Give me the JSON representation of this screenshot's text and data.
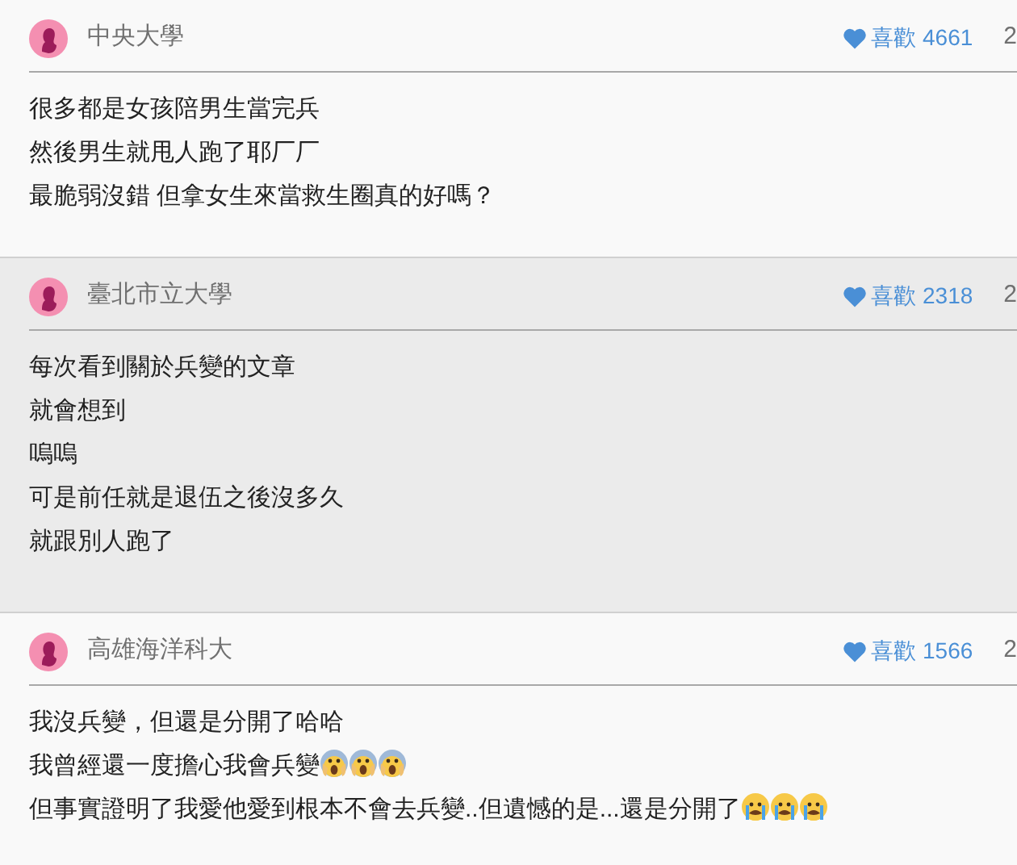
{
  "posts": [
    {
      "school": "中央大學",
      "likes": "喜歡 4661",
      "edge_text": "2",
      "highlighted": false,
      "lines": [
        {
          "text": "很多都是女孩陪男生當完兵"
        },
        {
          "text": "然後男生就甩人跑了耶厂厂"
        },
        {
          "text": "最脆弱沒錯 但拿女生來當救生圈真的好嗎？"
        }
      ]
    },
    {
      "school": "臺北市立大學",
      "likes": "喜歡 2318",
      "edge_text": "2",
      "highlighted": true,
      "lines": [
        {
          "text": "每次看到關於兵變的文章"
        },
        {
          "text": "就會想到"
        },
        {
          "text": "嗚嗚"
        },
        {
          "text": "可是前任就是退伍之後沒多久"
        },
        {
          "text": "就跟別人跑了"
        }
      ]
    },
    {
      "school": "高雄海洋科大",
      "likes": "喜歡 1566",
      "edge_text": "2",
      "highlighted": false,
      "lines": [
        {
          "text": "我沒兵變，但還是分開了哈哈"
        },
        {
          "text": "我曾經還一度擔心我會兵變",
          "trailing_icons": [
            {
              "kind": "scream"
            },
            {
              "kind": "scream"
            },
            {
              "kind": "scream"
            }
          ]
        },
        {
          "text": "但事實證明了我愛他愛到根本不會去兵變..但遺憾的是...還是分開了",
          "trailing_icons": [
            {
              "kind": "cry"
            },
            {
              "kind": "cry"
            },
            {
              "kind": "cry"
            }
          ]
        }
      ]
    }
  ]
}
